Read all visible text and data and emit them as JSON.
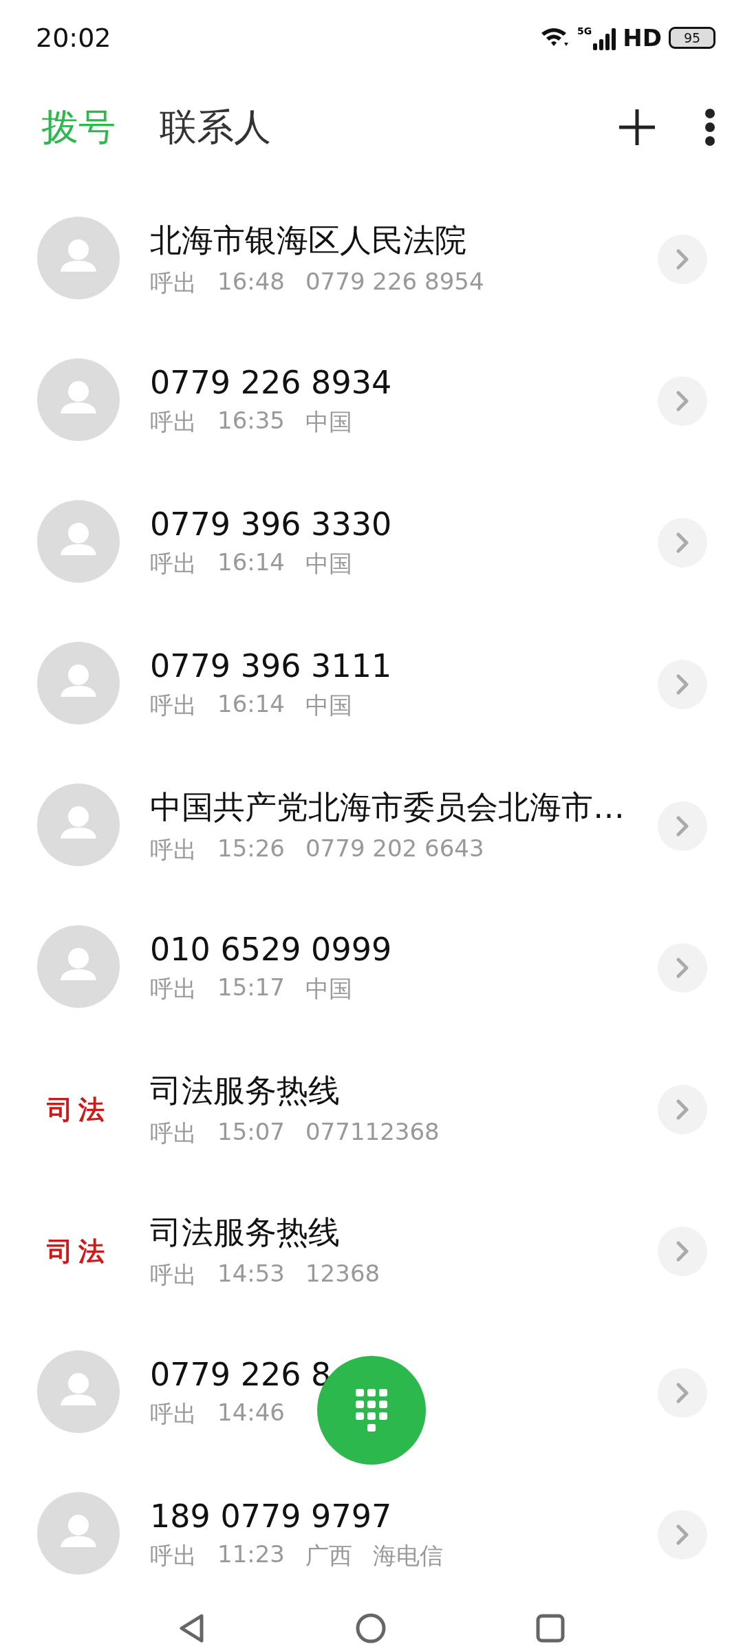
{
  "status_bar": {
    "time": "20:02",
    "network": "5G",
    "hd": "HD",
    "battery": "95"
  },
  "header": {
    "tabs": [
      {
        "label": "拨号",
        "selected": true
      },
      {
        "label": "联系人",
        "selected": false
      }
    ]
  },
  "calls": [
    {
      "avatar": {
        "kind": "person"
      },
      "name": "北海市银海区人民法院",
      "details": [
        "呼出",
        "16:48",
        "0779 226 8954"
      ]
    },
    {
      "avatar": {
        "kind": "person"
      },
      "name": "0779 226 8934",
      "details": [
        "呼出",
        "16:35",
        "中国"
      ]
    },
    {
      "avatar": {
        "kind": "person"
      },
      "name": "0779 396 3330",
      "details": [
        "呼出",
        "16:14",
        "中国"
      ]
    },
    {
      "avatar": {
        "kind": "person"
      },
      "name": "0779 396 3111",
      "details": [
        "呼出",
        "16:14",
        "中国"
      ]
    },
    {
      "avatar": {
        "kind": "person"
      },
      "name": "中国共产党北海市委员会北海市…",
      "details": [
        "呼出",
        "15:26",
        "0779 202 6643"
      ]
    },
    {
      "avatar": {
        "kind": "person"
      },
      "name": "010 6529 0999",
      "details": [
        "呼出",
        "15:17",
        "中国"
      ]
    },
    {
      "avatar": {
        "kind": "badge",
        "text": "司法"
      },
      "name": "司法服务热线",
      "details": [
        "呼出",
        "15:07",
        "077112368"
      ]
    },
    {
      "avatar": {
        "kind": "badge",
        "text": "司法"
      },
      "name": "司法服务热线",
      "details": [
        "呼出",
        "14:53",
        "12368"
      ]
    },
    {
      "avatar": {
        "kind": "person"
      },
      "name": "0779 226 8",
      "details": [
        "呼出",
        "14:46"
      ]
    },
    {
      "avatar": {
        "kind": "person"
      },
      "name": "189 0779 9797",
      "details": [
        "呼出",
        "11:23",
        "广西",
        "海电信"
      ]
    }
  ]
}
